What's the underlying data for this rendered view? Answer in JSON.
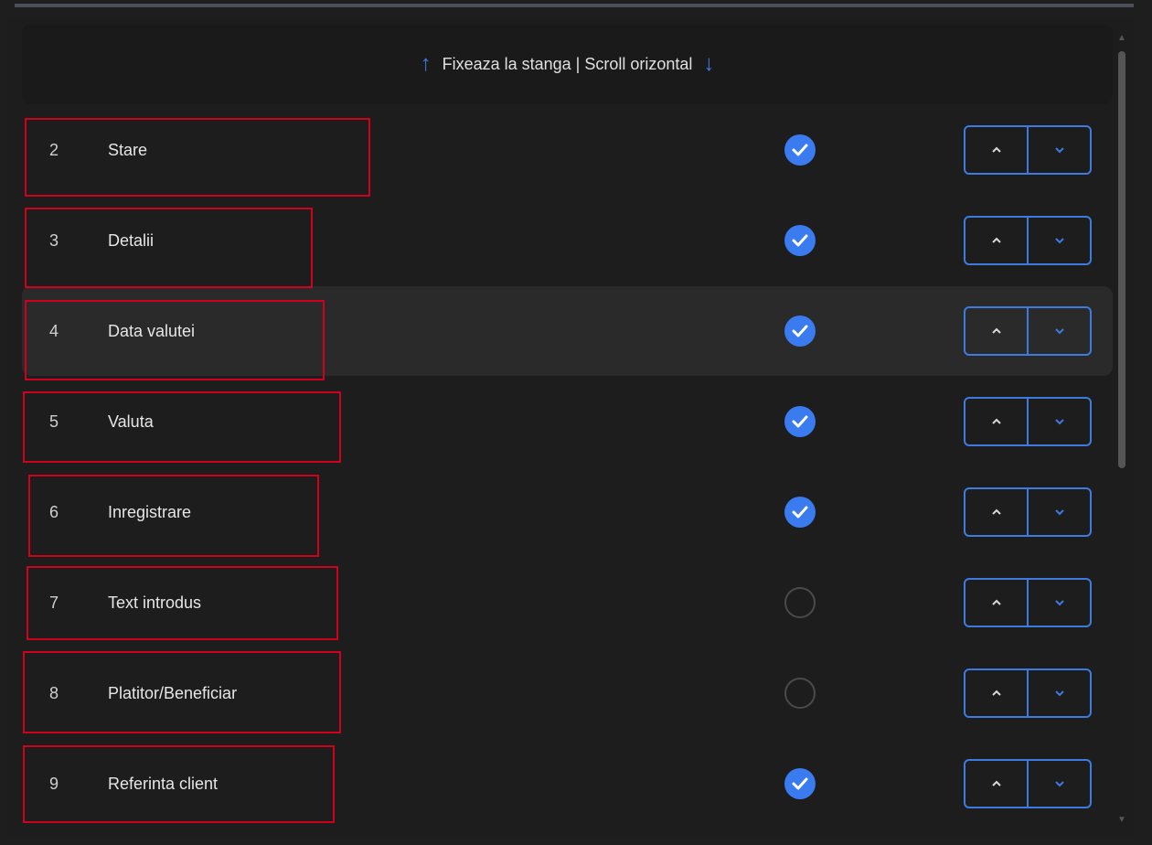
{
  "header": {
    "title": "Fixeaza la stanga | Scroll orizontal",
    "up_icon": "arrow-up-icon",
    "down_icon": "arrow-down-icon"
  },
  "rows": [
    {
      "num": "2",
      "label": "Stare",
      "checked": true
    },
    {
      "num": "3",
      "label": "Detalii",
      "checked": true
    },
    {
      "num": "4",
      "label": "Data valutei",
      "checked": true
    },
    {
      "num": "5",
      "label": "Valuta",
      "checked": true
    },
    {
      "num": "6",
      "label": "Inregistrare",
      "checked": true
    },
    {
      "num": "7",
      "label": "Text introdus",
      "checked": false
    },
    {
      "num": "8",
      "label": "Platitor/Beneficiar",
      "checked": false
    },
    {
      "num": "9",
      "label": "Referinta client",
      "checked": true
    }
  ],
  "colors": {
    "accent": "#3d7be0",
    "check_on": "#3a7bf0",
    "annotation": "#d0021b",
    "background": "#1e1e1e"
  }
}
